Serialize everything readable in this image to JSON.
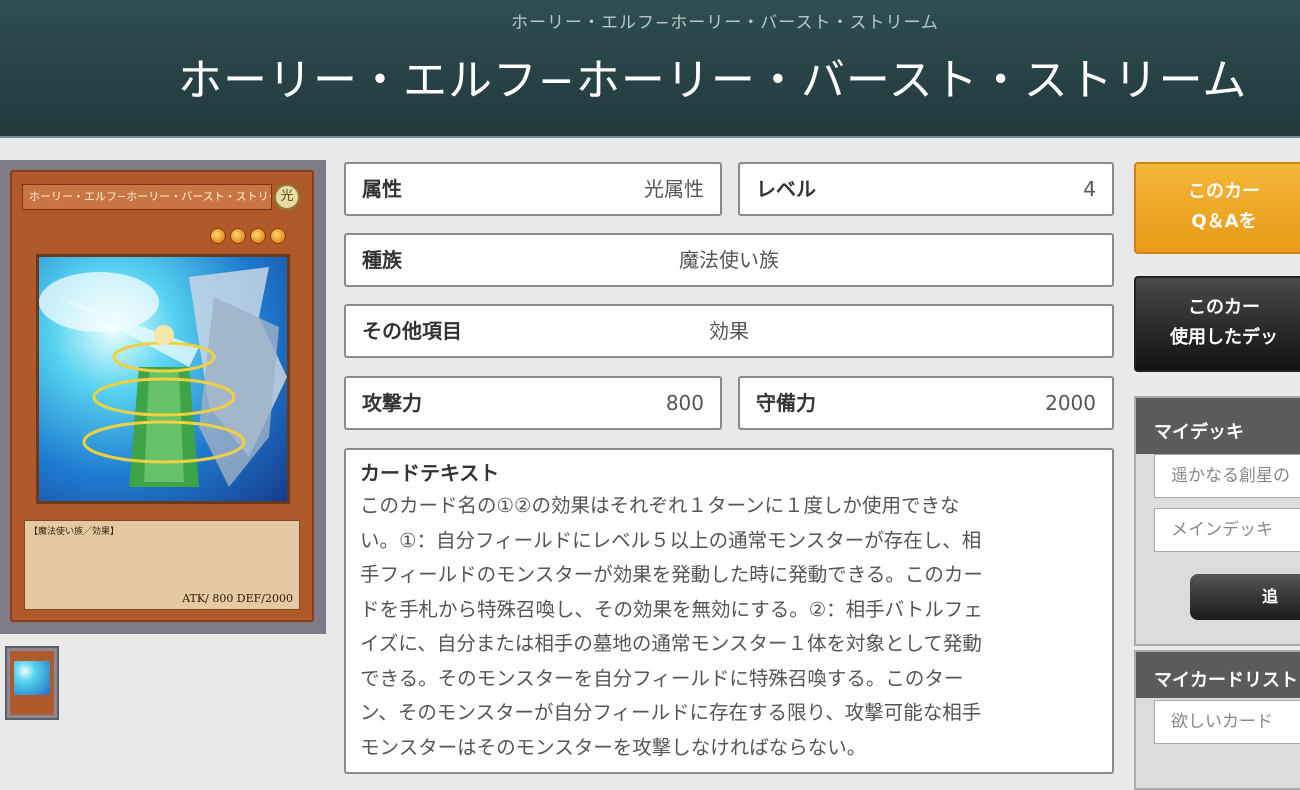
{
  "header": {
    "ruby": "ホーリー・エルフ−ホーリー・バースト・ストリーム",
    "title": "ホーリー・エルフ−ホーリー・バースト・ストリーム"
  },
  "card_image": {
    "name_text": "ホーリー・エルフ−ホーリー・バースト・ストリーム",
    "attribute_glyph": "光",
    "level": 4,
    "type_line": "【魔法使い族／効果】",
    "stats_line": "ATK/  800  DEF/2000"
  },
  "fields": {
    "attribute": {
      "label": "属性",
      "value": "光属性"
    },
    "level": {
      "label": "レベル",
      "value": "4"
    },
    "race": {
      "label": "種族",
      "value": "魔法使い族"
    },
    "other": {
      "label": "その他項目",
      "value": "効果"
    },
    "atk": {
      "label": "攻撃力",
      "value": "800"
    },
    "def": {
      "label": "守備力",
      "value": "2000"
    }
  },
  "card_text": {
    "label": "カードテキスト",
    "lines": [
      "このカード名の①②の効果はそれぞれ１ターンに１度しか使用できな",
      "い。①：自分フィールドにレベル５以上の通常モンスターが存在し、相",
      "手フィールドのモンスターが効果を発動した時に発動できる。このカー",
      "ドを手札から特殊召喚し、その効果を無効にする。②：相手バトルフェ",
      "イズに、自分または相手の墓地の通常モンスター１体を対象として発動",
      "できる。そのモンスターを自分フィールドに特殊召喚する。このター",
      "ン、そのモンスターが自分フィールドに存在する限り、攻撃可能な相手",
      "モンスターはそのモンスターを攻撃しなければならない。"
    ]
  },
  "sidebar": {
    "qa_button": {
      "line1": "このカー",
      "line2": "Q＆Aを"
    },
    "deck_button": {
      "line1": "このカー",
      "line2": "使用したデッ"
    },
    "mydeck": {
      "title": "マイデッキ",
      "deck_select": "遥かなる創星の",
      "deck_type_select": "メインデッキ",
      "add_button": "追"
    },
    "mycardlist": {
      "title": "マイカードリスト",
      "list_select": "欲しいカード"
    }
  },
  "colors": {
    "header_bg": "#2f4d54",
    "qa_button": "#f0a925",
    "deck_button": "#222222"
  }
}
